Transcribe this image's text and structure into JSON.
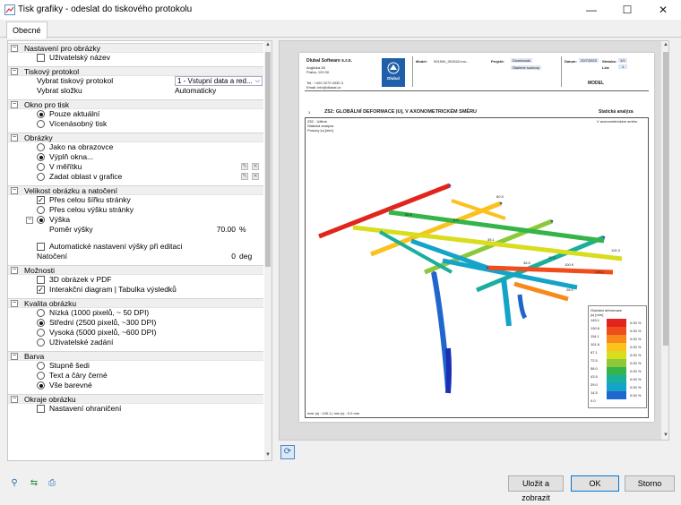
{
  "window": {
    "title": "Tisk grafiky - odeslat do tiskového protokolu"
  },
  "tabs": [
    {
      "label": "Obecné"
    }
  ],
  "sections": {
    "nastaveni": {
      "title": "Nastavení pro obrázky",
      "user_name": "Uživatelský název"
    },
    "protokol": {
      "title": "Tiskový protokol",
      "select_label": "Vybrat tiskový protokol",
      "select_value": "1 - Vstupní data a red...",
      "folder_label": "Vybrat složku",
      "folder_value": "Automaticky"
    },
    "okno": {
      "title": "Okno pro tisk",
      "current": "Pouze aktuální",
      "multi": "Vícenásobný tisk"
    },
    "obrazky": {
      "title": "Obrázky",
      "as_screen": "Jako na obrazovce",
      "fill": "Výplň okna...",
      "scale": "V měřítku",
      "area": "Zadat oblast v grafice"
    },
    "velikost": {
      "title": "Velikost obrázku a natočení",
      "full_width": "Přes celou šířku stránky",
      "full_height": "Přes celou výšku stránky",
      "height": "Výška",
      "ratio_label": "Poměr výšky",
      "ratio_value": "70.00",
      "ratio_unit": "%",
      "auto_height": "Automatické nastavení výšky při editaci",
      "rotation_label": "Natočení",
      "rotation_value": "0",
      "rotation_unit": "deg"
    },
    "moznosti": {
      "title": "Možnosti",
      "pdf3d": "3D obrázek v PDF",
      "interactive": "Interakční diagram | Tabulka výsledků"
    },
    "kvalita": {
      "title": "Kvalita obrázku",
      "low": "Nízká (1000 pixelů, ~ 50 DPI)",
      "mid": "Střední (2500 pixelů, ~300 DPI)",
      "high": "Vysoká (5000 pixelů, ~600 DPI)",
      "user": "Uživatelské zadání"
    },
    "barva": {
      "title": "Barva",
      "gray": "Stupně šedi",
      "bw": "Text a čáry černé",
      "color": "Vše barevné"
    },
    "okraje": {
      "title": "Okraje obrázku",
      "limits": "Nastavení ohraničení"
    }
  },
  "preview": {
    "company": "Dlubal Software s.r.o.",
    "addr1": "Anglická 28",
    "addr2": "Praha, 120 00",
    "phone": "Tel.: +420 2272 0330 3",
    "email": "Email: info@dlubal.cz",
    "logo": "Dlubal",
    "model_label": "Model:",
    "model_value": "001594_001542-mo...",
    "project_label": "Projekt:",
    "project_value": "Downloads",
    "project_sub": "Stažené soubory",
    "date_label": "Datum:",
    "date_value": "20/7/2023",
    "page_label": "Stránka:",
    "page_value": "1/1",
    "sheet_label": "List:",
    "sheet_value": "1",
    "model_box": "MODEL",
    "num": "1",
    "heading": "Z52: GLOBÁLNÍ DEFORMACE |U|, V AXONOMETRICKÉM SMĚRU",
    "analysis": "Statická analýza",
    "meta1": "Z52 - Užitná",
    "meta2": "Statická analýza",
    "meta3": "Posuny |u| [mm]",
    "view_dir": "V axonometrickém směru",
    "labels": [
      "60.9",
      "56.8",
      "8.6",
      "35.1",
      "36.5",
      "115.3",
      "20.3",
      "100.9",
      "26.0",
      "145.1"
    ],
    "footer": "max |u| : 145.1 | min |u| : 0.0 mm",
    "legend": {
      "title": "Globální deformace",
      "unit": "|u| [mm]",
      "values": [
        "145.1",
        "130.6",
        "116.1",
        "101.6",
        "87.1",
        "72.5",
        "58.0",
        "43.5",
        "29.0",
        "14.5",
        "0.0"
      ],
      "pct": "0.00 %"
    }
  },
  "buttons": {
    "save": "Uložit a zobrazit",
    "ok": "OK",
    "cancel": "Storno"
  },
  "colors": {
    "accent": "#0078d7",
    "legend": [
      "#e1241c",
      "#f04d1c",
      "#f78a1a",
      "#fbc11c",
      "#d8dd1d",
      "#8cc83a",
      "#34b44a",
      "#1aae9c",
      "#14a3c9",
      "#2066cf",
      "#1c2fb3",
      "#101a8c"
    ]
  }
}
